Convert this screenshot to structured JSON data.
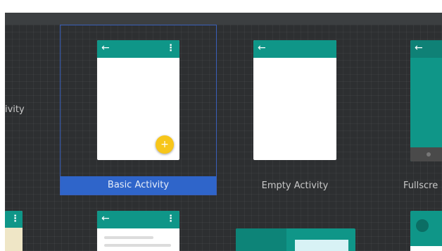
{
  "gallery": {
    "partial_left_label": "ivity",
    "tiles": [
      {
        "label": "Basic Activity",
        "selected": true
      },
      {
        "label": "Empty Activity",
        "selected": false
      },
      {
        "label": "Fullscre",
        "selected": false
      }
    ]
  },
  "icons": {
    "back_arrow": "←",
    "overflow_menu": "⋮",
    "fab_plus": "+"
  },
  "colors": {
    "teal": "#0f9688",
    "selection": "#2f65ca",
    "fab": "#f7c61a"
  }
}
